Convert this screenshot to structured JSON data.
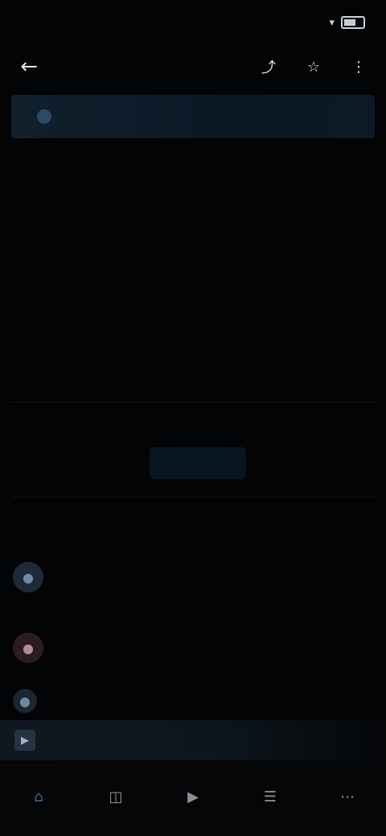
{
  "status": {
    "time": "",
    "right_text": ""
  },
  "header": {
    "logo": "",
    "icons": [
      "share-icon",
      "star-icon",
      "more-icon"
    ]
  },
  "banner": {
    "title": ""
  },
  "tabs": [
    "",
    "",
    "",
    "",
    "",
    "",
    ""
  ],
  "periods": [
    "",
    "",
    "",
    "",
    ""
  ],
  "section1": {
    "label": "",
    "link": ""
  },
  "team_a": {
    "name": ""
  },
  "team_b": {
    "name": ""
  },
  "score": {
    "main": "",
    "sub": ""
  },
  "section2": {
    "label": ""
  },
  "cta": {
    "label": ""
  },
  "section3": {
    "label": "",
    "link": ""
  },
  "list": [
    {
      "title": "",
      "sub": "",
      "right": ""
    },
    {
      "title": "",
      "sub": "",
      "right": ""
    },
    {
      "title": "",
      "sub": "",
      "right": ""
    }
  ],
  "mini_player": {
    "title": ""
  },
  "bottom_nav": [
    {
      "label": "",
      "icon": "home-icon"
    },
    {
      "label": "",
      "icon": "scores-icon"
    },
    {
      "label": "",
      "icon": "watch-icon"
    },
    {
      "label": "",
      "icon": "news-icon"
    },
    {
      "label": "",
      "icon": "more-icon"
    }
  ],
  "colors": {
    "accent": "#3c6a94",
    "background": "#030405",
    "banner": "#0a1826"
  }
}
